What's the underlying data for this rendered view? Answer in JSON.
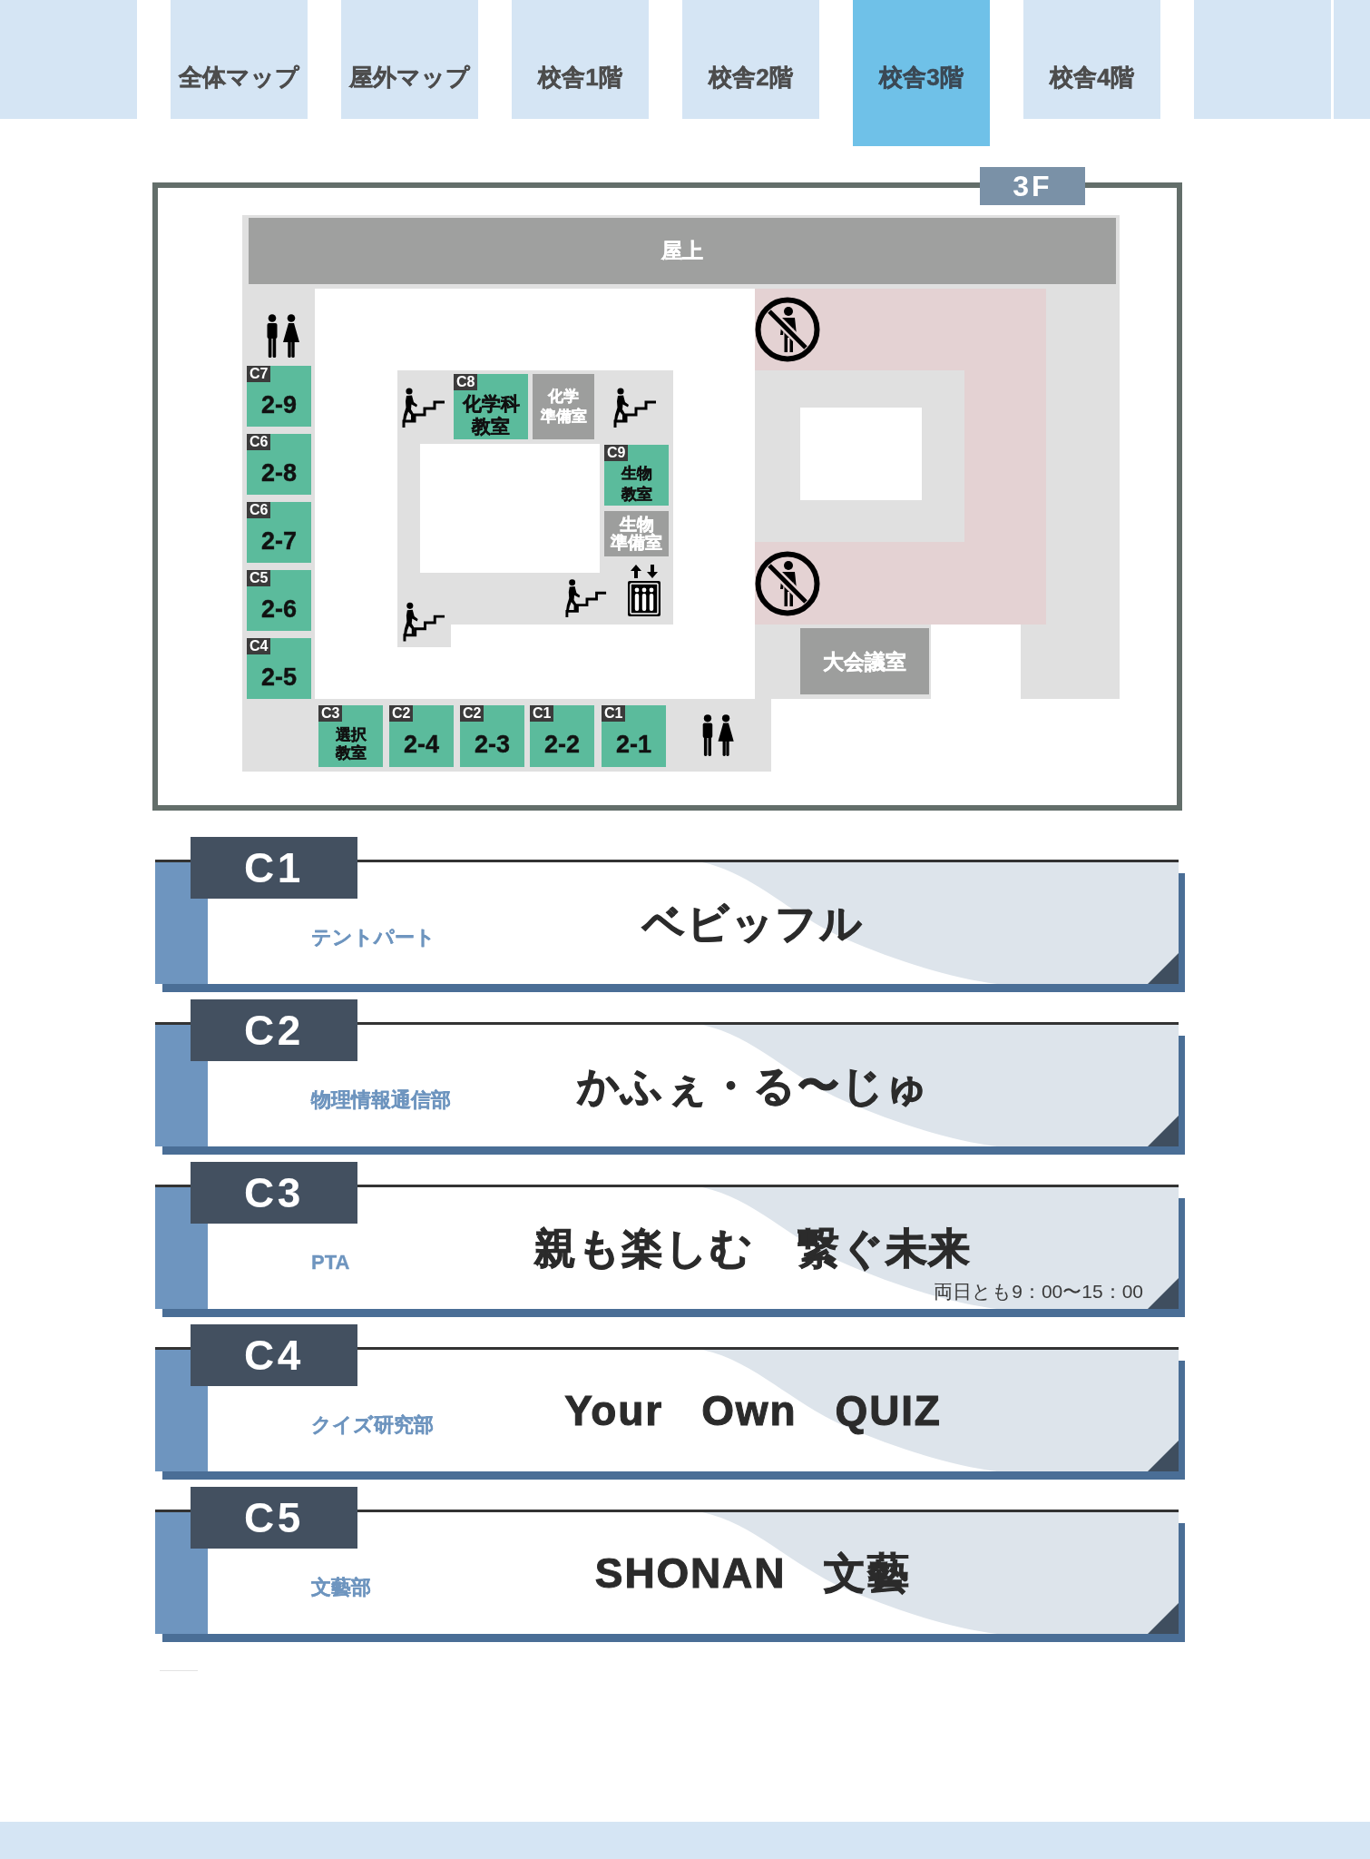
{
  "tabs": [
    {
      "label": "全体マップ",
      "selected": false
    },
    {
      "label": "屋外マップ",
      "selected": false
    },
    {
      "label": "校舎1階",
      "selected": false
    },
    {
      "label": "校舎2階",
      "selected": false
    },
    {
      "label": "校舎3階",
      "selected": true
    },
    {
      "label": "校舎4階",
      "selected": false
    }
  ],
  "floor_map": {
    "floor_label": "3F",
    "rooftop": "屋上",
    "rooms": [
      {
        "kind": "classroom",
        "code": "C7",
        "lines": [
          "2-9"
        ]
      },
      {
        "kind": "classroom",
        "code": "C6",
        "lines": [
          "2-8"
        ]
      },
      {
        "kind": "classroom",
        "code": "C6",
        "lines": [
          "2-7"
        ]
      },
      {
        "kind": "classroom",
        "code": "C5",
        "lines": [
          "2-6"
        ]
      },
      {
        "kind": "classroom",
        "code": "C4",
        "lines": [
          "2-5"
        ]
      },
      {
        "kind": "classroom",
        "code": "C8",
        "lines": [
          "化学科",
          "教室"
        ]
      },
      {
        "kind": "facility",
        "lines": [
          "化学",
          "準備室"
        ]
      },
      {
        "kind": "classroom",
        "code": "C9",
        "lines": [
          "生物",
          "教室"
        ]
      },
      {
        "kind": "facility",
        "lines": [
          "生物",
          "準備室"
        ]
      },
      {
        "kind": "facility",
        "lines": [
          "大会議室"
        ]
      },
      {
        "kind": "classroom",
        "code": "C3",
        "lines": [
          "選択",
          "教室"
        ]
      },
      {
        "kind": "classroom",
        "code": "C2",
        "lines": [
          "2-4"
        ]
      },
      {
        "kind": "classroom",
        "code": "C2",
        "lines": [
          "2-3"
        ]
      },
      {
        "kind": "classroom",
        "code": "C1",
        "lines": [
          "2-2"
        ]
      },
      {
        "kind": "classroom",
        "code": "C1",
        "lines": [
          "2-1"
        ]
      }
    ]
  },
  "booths": [
    {
      "code": "C1",
      "club": "テントパート",
      "title": "ベビッフル"
    },
    {
      "code": "C2",
      "club": "物理情報通信部",
      "title": "かふぇ・る〜じゅ"
    },
    {
      "code": "C3",
      "club": "PTA",
      "title": "親も楽しむ　繋ぐ未来",
      "note": "両日とも9：00〜15：00"
    },
    {
      "code": "C4",
      "club": "クイズ研究部",
      "title": "Your Own QUIZ"
    },
    {
      "code": "C5",
      "club": "文藝部",
      "title": "SHONAN 文藝"
    }
  ]
}
